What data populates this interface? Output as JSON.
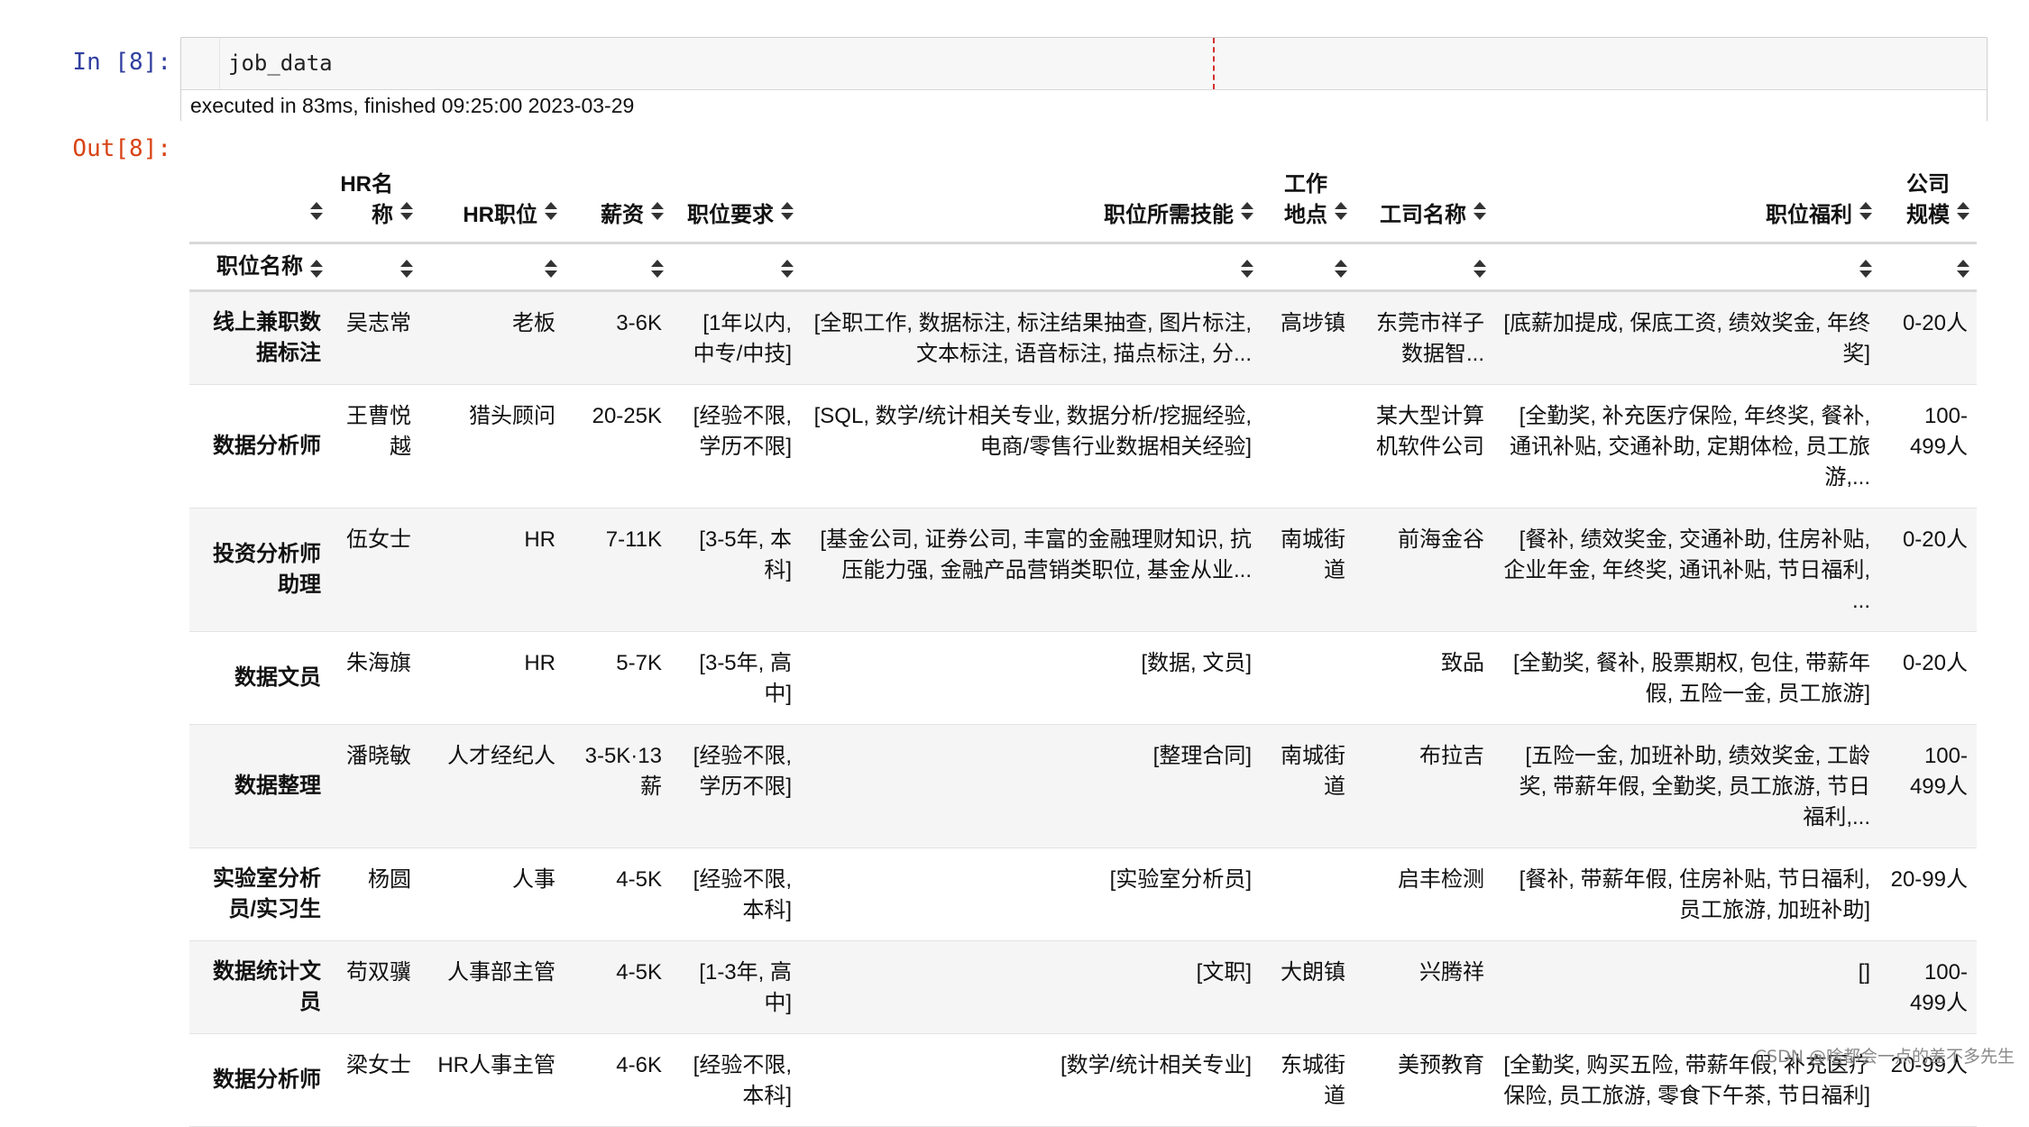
{
  "notebook": {
    "in_prompt": "In  [8]:",
    "code": "job_data",
    "exec_info": "executed in 83ms, finished 09:25:00 2023-03-29",
    "out_prompt": "Out[8]:"
  },
  "table": {
    "columns": [
      "HR名称",
      "HR职位",
      "薪资",
      "职位要求",
      "职位所需技能",
      "工作地点",
      "工司名称",
      "职位福利",
      "公司规模"
    ],
    "index_name": "职位名称",
    "rows": [
      {
        "index": "线上兼职数据标注",
        "cells": [
          "吴志常",
          "老板",
          "3-6K",
          "[1年以内, 中专/中技]",
          "[全职工作, 数据标注, 标注结果抽查, 图片标注, 文本标注, 语音标注, 描点标注, 分...",
          "高埗镇",
          "东莞市祥子数据智...",
          "[底薪加提成, 保底工资, 绩效奖金, 年终奖]",
          "0-20人"
        ]
      },
      {
        "index": "数据分析师",
        "cells": [
          "王曹悦越",
          "猎头顾问",
          "20-25K",
          "[经验不限, 学历不限]",
          "[SQL, 数学/统计相关专业, 数据分析/挖掘经验, 电商/零售行业数据相关经验]",
          "",
          "某大型计算机软件公司",
          "[全勤奖, 补充医疗保险, 年终奖, 餐补, 通讯补贴, 交通补助, 定期体检, 员工旅游,...",
          "100-499人"
        ]
      },
      {
        "index": "投资分析师助理",
        "cells": [
          "伍女士",
          "HR",
          "7-11K",
          "[3-5年, 本科]",
          "[基金公司, 证券公司, 丰富的金融理财知识, 抗压能力强, 金融产品营销类职位, 基金从业...",
          "南城街道",
          "前海金谷",
          "[餐补, 绩效奖金, 交通补助, 住房补贴, 企业年金, 年终奖, 通讯补贴, 节日福利, ...",
          "0-20人"
        ]
      },
      {
        "index": "数据文员",
        "cells": [
          "朱海旗",
          "HR",
          "5-7K",
          "[3-5年, 高中]",
          "[数据, 文员]",
          "",
          "致品",
          "[全勤奖, 餐补, 股票期权, 包住, 带薪年假, 五险一金, 员工旅游]",
          "0-20人"
        ]
      },
      {
        "index": "数据整理",
        "cells": [
          "潘晓敏",
          "人才经纪人",
          "3-5K·13薪",
          "[经验不限, 学历不限]",
          "[整理合同]",
          "南城街道",
          "布拉吉",
          "[五险一金, 加班补助, 绩效奖金, 工龄奖, 带薪年假, 全勤奖, 员工旅游, 节日福利,...",
          "100-499人"
        ]
      },
      {
        "index": "实验室分析员/实习生",
        "cells": [
          "杨圆",
          "人事",
          "4-5K",
          "[经验不限, 本科]",
          "[实验室分析员]",
          "",
          "启丰检测",
          "[餐补, 带薪年假, 住房补贴, 节日福利, 员工旅游, 加班补助]",
          "20-99人"
        ]
      },
      {
        "index": "数据统计文员",
        "cells": [
          "苟双骥",
          "人事部主管",
          "4-5K",
          "[1-3年, 高中]",
          "[文职]",
          "大朗镇",
          "兴腾祥",
          "[]",
          "100-499人"
        ]
      },
      {
        "index": "数据分析师",
        "cells": [
          "梁女士",
          "HR人事主管",
          "4-6K",
          "[经验不限, 本科]",
          "[数学/统计相关专业]",
          "东城街道",
          "美预教育",
          "[全勤奖, 购买五险, 带薪年假, 补充医疗保险, 员工旅游, 零食下午茶, 节日福利]",
          "20-99人"
        ]
      }
    ]
  },
  "watermark": "CSDN @啥都会一点的差不多先生"
}
